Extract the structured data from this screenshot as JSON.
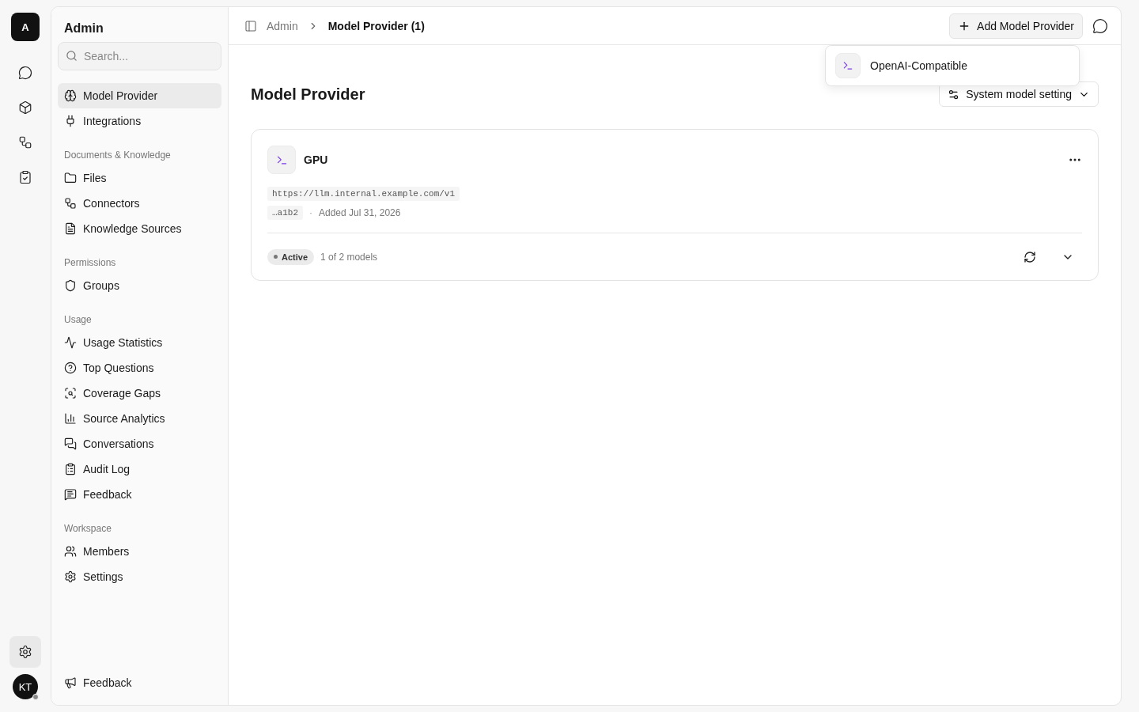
{
  "rail": {
    "logo": "A",
    "settings_selected": true,
    "avatar": "KT"
  },
  "sidebar": {
    "title": "Admin",
    "search": {
      "placeholder": "Search..."
    },
    "groups": [
      {
        "items": [
          {
            "label": "Model Provider",
            "selected": true
          },
          {
            "label": "Integrations",
            "selected": false
          }
        ]
      },
      {
        "heading": "Documents & Knowledge",
        "items": [
          {
            "label": "Files",
            "selected": false
          },
          {
            "label": "Connectors",
            "selected": false
          },
          {
            "label": "Knowledge Sources",
            "selected": false
          }
        ]
      },
      {
        "heading": "Permissions",
        "items": [
          {
            "label": "Groups",
            "selected": false
          }
        ]
      },
      {
        "heading": "Usage",
        "items": [
          {
            "label": "Usage Statistics",
            "selected": false
          },
          {
            "label": "Top Questions",
            "selected": false
          },
          {
            "label": "Coverage Gaps",
            "selected": false
          },
          {
            "label": "Source Analytics",
            "selected": false
          },
          {
            "label": "Conversations",
            "selected": false
          },
          {
            "label": "Audit Log",
            "selected": false
          },
          {
            "label": "Feedback",
            "selected": false
          }
        ]
      },
      {
        "heading": "Workspace",
        "items": [
          {
            "label": "Members",
            "selected": false
          },
          {
            "label": "Settings",
            "selected": false
          }
        ]
      }
    ],
    "footer": "Feedback"
  },
  "header": {
    "breadcrumb": [
      "Admin",
      "Model Provider (1)"
    ],
    "add_button": "Add Model Provider",
    "menu": [
      "OpenAI-Compatible"
    ]
  },
  "page": {
    "title": "Model Provider",
    "settings_button": "System model setting",
    "providers": [
      {
        "name": "GPU",
        "url": "https://llm.internal.example.com/v1",
        "key": "…a1b2",
        "separator": "·",
        "added": "Added Jul 31, 2026",
        "status": "Active",
        "models": "1 of 2 models"
      }
    ]
  }
}
